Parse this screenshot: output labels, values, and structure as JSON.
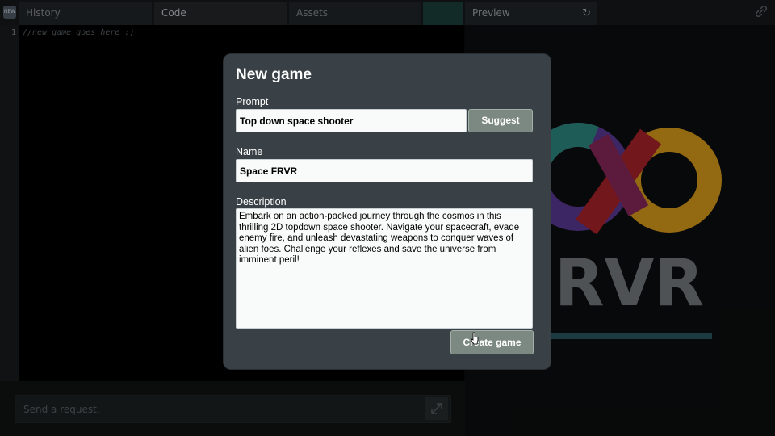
{
  "topbar": {
    "new_badge": "NEW",
    "tabs": [
      {
        "label": "History"
      },
      {
        "label": "Code"
      },
      {
        "label": "Assets"
      }
    ],
    "preview": {
      "label": "Preview",
      "refresh_icon": "refresh-icon"
    },
    "link_icon": "link-icon"
  },
  "editor": {
    "line_number": "1",
    "code": "//new game goes here :)"
  },
  "chat": {
    "placeholder": "Send a request.",
    "expand_icon": "expand-icon"
  },
  "preview": {
    "logo_text": "FRVR",
    "colors": {
      "teal": "#2f8f86",
      "purple": "#5d3b9a",
      "red": "#b0242c",
      "yellow": "#e2a31d"
    }
  },
  "modal": {
    "title": "New game",
    "prompt_label": "Prompt",
    "prompt_value": "Top down space shooter",
    "suggest_label": "Suggest",
    "name_label": "Name",
    "name_value": "Space FRVR",
    "description_label": "Description",
    "description_value": "Embark on an action-packed journey through the cosmos in this thrilling 2D topdown space shooter. Navigate your spacecraft, evade enemy fire, and unleash devastating weapons to conquer waves of alien foes. Challenge your reflexes and save the universe from imminent peril!",
    "create_label": "Create game"
  }
}
